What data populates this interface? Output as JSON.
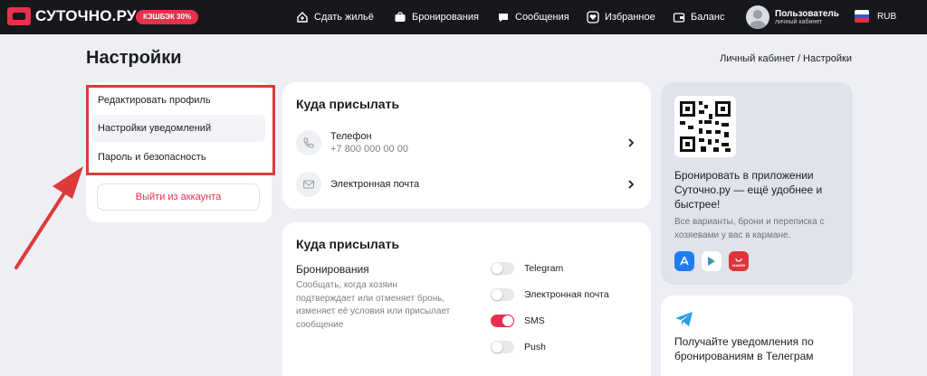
{
  "header": {
    "logo_text": "СУТОЧНО.РУ",
    "cashback_badge": "КЭШБЭК 30%",
    "nav": [
      {
        "label": "Сдать жильё",
        "icon": "house-plus-icon"
      },
      {
        "label": "Бронирования",
        "icon": "briefcase-icon"
      },
      {
        "label": "Сообщения",
        "icon": "chat-icon"
      },
      {
        "label": "Избранное",
        "icon": "heart-icon"
      },
      {
        "label": "Баланс",
        "icon": "wallet-icon"
      }
    ],
    "user": {
      "name": "Пользователь",
      "subtitle": "личный кабинет"
    },
    "currency": "RUB"
  },
  "page": {
    "title": "Настройки",
    "breadcrumb": "Личный кабинет / Настройки"
  },
  "sidebar": {
    "items": [
      {
        "label": "Редактировать профиль"
      },
      {
        "label": "Настройки уведомлений",
        "active": true
      },
      {
        "label": "Пароль и безопасность"
      }
    ],
    "logout": "Выйти из аккаунта"
  },
  "contact_card": {
    "title": "Куда присылать",
    "phone": {
      "label": "Телефон",
      "value": "+7 800 000 00 00"
    },
    "email": {
      "label": "Электронная почта"
    }
  },
  "notify_card": {
    "title": "Куда присылать",
    "section_label": "Бронирования",
    "section_desc": "Сообщать, когда хозяин подтверждает или отменяет бронь, изменяет её условия или присылает сообщение",
    "channels": [
      {
        "label": "Telegram",
        "enabled": false
      },
      {
        "label": "Электронная почта",
        "enabled": false
      },
      {
        "label": "SMS",
        "enabled": true
      },
      {
        "label": "Push",
        "enabled": false
      }
    ]
  },
  "promo": {
    "title": "Бронировать в приложении Суточно.ру — ещё удобнее и быстрее!",
    "subtitle": "Все варианты, брони и переписка с хозяевами у вас в кармане.",
    "stores": [
      "app-store-icon",
      "google-play-icon",
      "huawei-appgallery-icon"
    ],
    "huawei_label": "HUAWEI"
  },
  "telegram_promo": {
    "title": "Получайте уведомления по бронированиям в Телеграм"
  },
  "colors": {
    "accent": "#e8304d",
    "header_bg": "#17181c",
    "page_bg": "#edeff4",
    "annotation_red": "#de3a3a"
  }
}
